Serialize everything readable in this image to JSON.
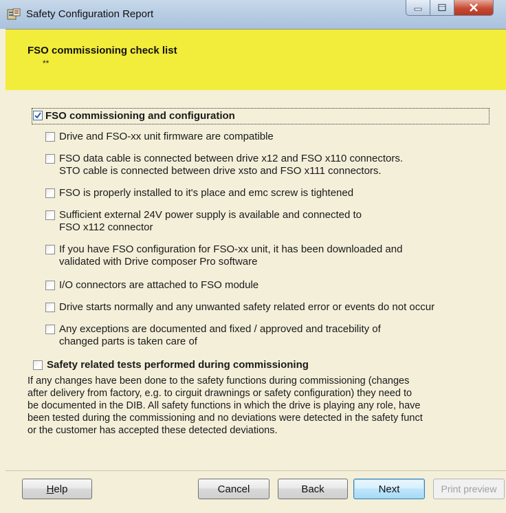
{
  "window": {
    "title": "Safety Configuration Report"
  },
  "header": {
    "title": "FSO commissioning check list",
    "subtitle": "**"
  },
  "checklist": {
    "section1": {
      "label": "FSO commissioning and configuration",
      "checked": true
    },
    "items": [
      {
        "lines": [
          "Drive and FSO-xx unit firmware are compatible"
        ],
        "checked": false
      },
      {
        "lines": [
          "FSO data cable is connected between drive x12 and FSO x110 connectors.",
          "STO cable is connected between drive xsto and FSO x111 connectors."
        ],
        "checked": false
      },
      {
        "lines": [
          "FSO is properly installed to it's place and emc screw is tightened"
        ],
        "checked": false
      },
      {
        "lines": [
          "Sufficient external 24V power supply is available and connected to",
          "FSO x112 connector"
        ],
        "checked": false
      },
      {
        "lines": [
          "If you have FSO configuration for FSO-xx unit, it has been downloaded and",
          "validated with Drive composer Pro software"
        ],
        "checked": false
      },
      {
        "lines": [
          "I/O connectors are attached to FSO module"
        ],
        "checked": false
      },
      {
        "lines": [
          "Drive starts normally and any unwanted safety related error or events do not occur"
        ],
        "checked": false
      },
      {
        "lines": [
          "Any exceptions are documented and fixed / approved and tracebility of",
          "changed parts is taken care of"
        ],
        "checked": false
      }
    ],
    "section2": {
      "label": "Safety related tests performed during commissioning",
      "checked": false
    }
  },
  "note": {
    "lines": [
      "If any changes have been done to the safety functions during commissioning (changes",
      "after delivery from factory, e.g. to cirguit drawnings or safety configuration) they need to",
      "be documented in the DIB. All safety functions in which the drive is playing any role, have",
      "been tested during the commissioning and no deviations were detected in the safety funct",
      "or the customer has accepted these detected deviations."
    ]
  },
  "buttons": {
    "help": {
      "label_underlined": "H",
      "label_rest": "elp"
    },
    "cancel": "Cancel",
    "back": "Back",
    "next": "Next",
    "print_preview": "Print preview"
  },
  "colors": {
    "header_bg": "#f2ec3a",
    "content_bg": "#f3efd9",
    "check_accent": "#2a5db0"
  }
}
